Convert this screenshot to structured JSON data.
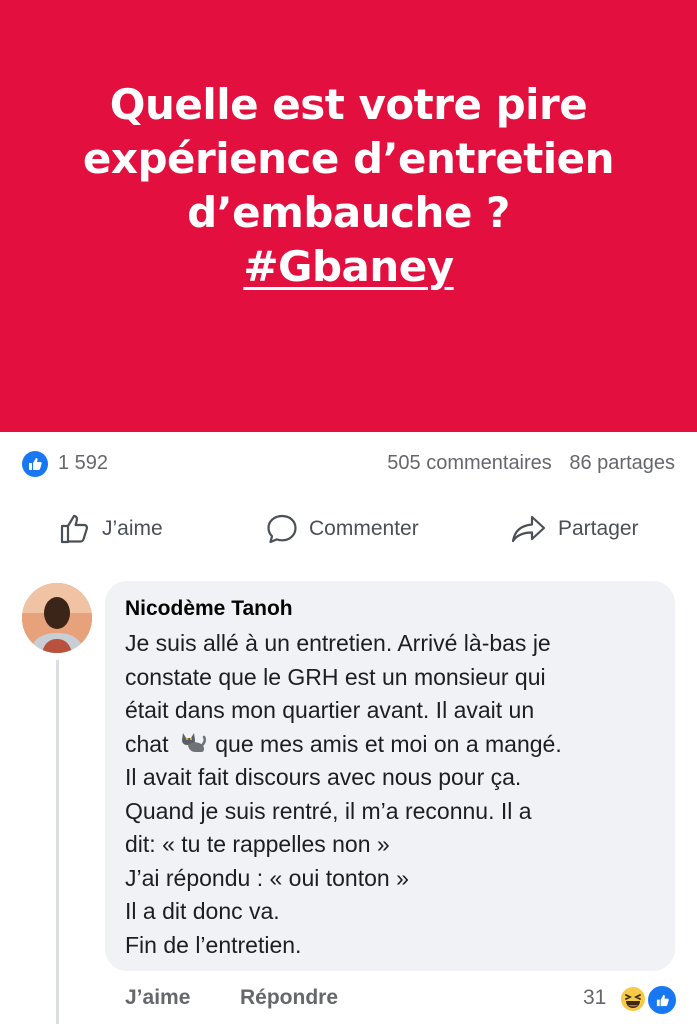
{
  "banner": {
    "line1": "Quelle est votre pire",
    "line2": "expérience d’entretien",
    "line3": "d’embauche ?",
    "hashtag": "#Gbaney",
    "background": "#e3103f"
  },
  "stats": {
    "likes": "1 592",
    "comments": "505 commentaires",
    "shares": "86 partages"
  },
  "actions": {
    "like": "J’aime",
    "comment": "Commenter",
    "share": "Partager"
  },
  "comment": {
    "author": "Nicodème Tanoh",
    "lines": [
      "Je suis allé à un entretien. Arrivé là-bas je",
      "constate que le GRH est un monsieur qui",
      "était dans mon quartier avant. Il avait un",
      "chat",
      "que mes amis et moi on a mangé.",
      "Il avait fait discours avec nous pour ça.",
      "Quand je suis rentré, il m’a reconnu. Il a",
      "dit: « tu te rappelles non »",
      "J’ai répondu : « oui tonton »",
      "Il a dit donc va.",
      "Fin de l’entretien."
    ],
    "emoji": "cat-emoji"
  },
  "comment_actions": {
    "like": "J’aime",
    "reply": "Répondre",
    "reaction_count": "31"
  },
  "icons": {
    "like_badge": "thumbs-up-icon",
    "like": "thumbs-up-outline-icon",
    "comment": "speech-bubble-icon",
    "share": "share-arrow-icon",
    "haha": "laughing-face-icon"
  },
  "colors": {
    "accent": "#1877f2",
    "muted_text": "#65676b",
    "bubble": "#f0f2f5"
  }
}
